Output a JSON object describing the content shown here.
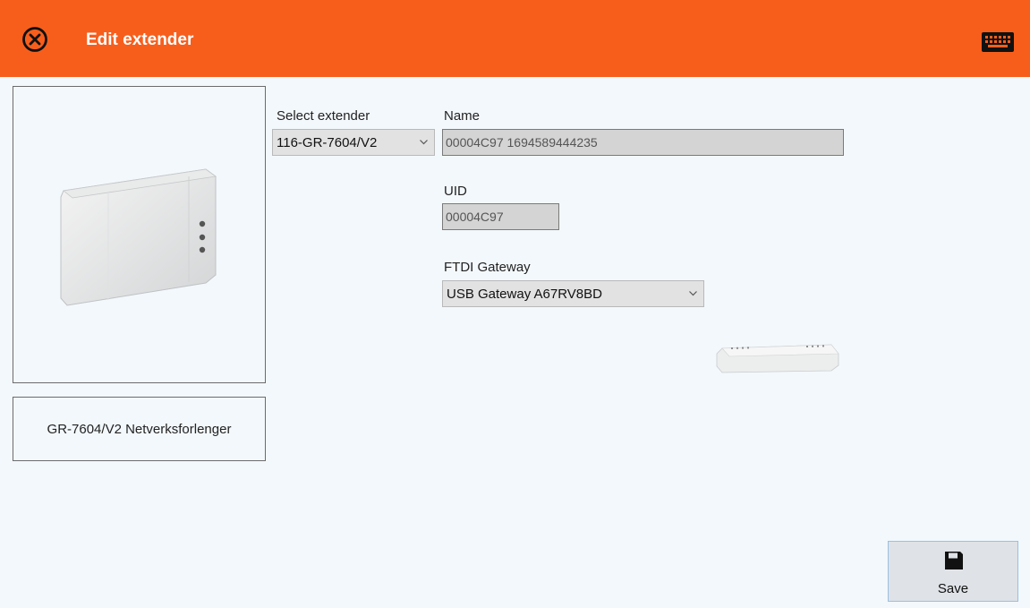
{
  "header": {
    "title": "Edit extender",
    "close_icon": "close-circle-icon",
    "keyboard_icon": "keyboard-icon",
    "background_color": "#f75e1c"
  },
  "product": {
    "description": "GR-7604/V2 Netverksforlenger"
  },
  "form": {
    "select_extender_label": "Select extender",
    "select_extender_value": "116-GR-7604/V2",
    "name_label": "Name",
    "name_value": "00004C97 1694589444235",
    "uid_label": "UID",
    "uid_value": "00004C97",
    "gateway_label": "FTDI Gateway",
    "gateway_value": "USB Gateway A67RV8BD"
  },
  "actions": {
    "save_label": "Save",
    "save_icon": "floppy-disk-icon"
  }
}
